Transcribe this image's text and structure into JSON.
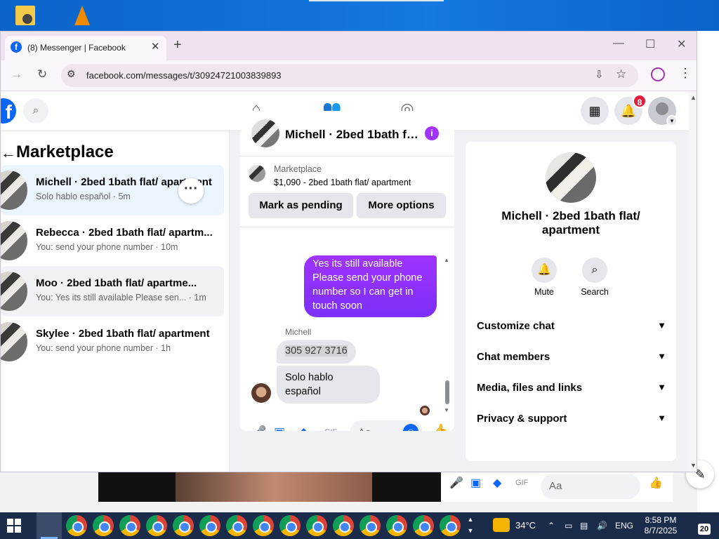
{
  "browser": {
    "tab_title": "(8) Messenger | Facebook",
    "url": "facebook.com/messages/t/30924721003839893"
  },
  "fb": {
    "notifications_count": "8"
  },
  "marketplace": {
    "title": "Marketplace",
    "chats": [
      {
        "name": "Michell · 2bed 1bath flat/ apartment",
        "preview": "Solo hablo español · 5m"
      },
      {
        "name": "Rebecca · 2bed 1bath flat/ apartm...",
        "preview": "You: send your phone number · 10m"
      },
      {
        "name": "Moo · 2bed 1bath flat/ apartme...",
        "preview": "You: Yes its still available Please sen... · 1m"
      },
      {
        "name": "Skylee · 2bed 1bath flat/ apartment",
        "preview": "You: send your phone number · 1h"
      }
    ]
  },
  "chat": {
    "header_name": "Michell · 2bed 1bath flat/ apartment",
    "marketplace_label": "Marketplace",
    "listing": "$1,090 - 2bed 1bath flat/ apartment",
    "mark_pending": "Mark as pending",
    "more_options": "More options",
    "outgoing_message": "Yes its still available Please send your phone number so I can get in touch soon",
    "sender": "Michell",
    "phone_message": "305 927 3716",
    "incoming_message": "Solo hablo español",
    "composer_placeholder": "Aa"
  },
  "info_panel": {
    "name": "Michell · 2bed 1bath flat/ apartment",
    "mute": "Mute",
    "search": "Search",
    "rows": [
      "Customize chat",
      "Chat members",
      "Media, files and links",
      "Privacy & support"
    ]
  },
  "behind_window": {
    "composer_placeholder": "Aa"
  },
  "taskbar": {
    "temperature": "34°C",
    "language": "ENG",
    "time": "8:58 PM",
    "date": "8/7/2025",
    "notification_count": "20"
  }
}
